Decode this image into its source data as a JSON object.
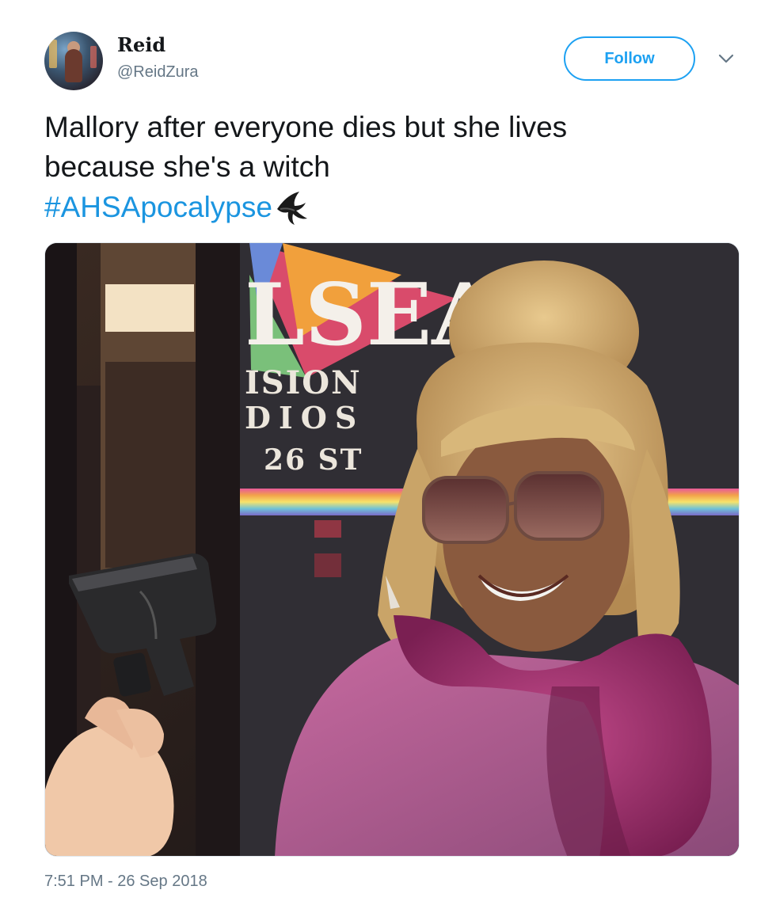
{
  "user": {
    "display_name": "Reid",
    "handle": "@ReidZura"
  },
  "header": {
    "follow_label": "Follow"
  },
  "tweet": {
    "text_line1": "Mallory after everyone dies but she lives",
    "text_line2": "because she's a witch",
    "hashtag": "#AHSApocalypse"
  },
  "media": {
    "sign_top": "LSEA",
    "sign_line1": "ISION",
    "sign_line2": "DIOS",
    "sign_line3": "26 ST"
  },
  "footer": {
    "timestamp": "7:51 PM - 26 Sep 2018"
  },
  "colors": {
    "accent": "#1da1f2",
    "hashtag": "#1b95e0",
    "secondary_text": "#657786"
  },
  "icons": [
    "chevron-down-icon",
    "witch-hat-emoji-icon"
  ]
}
